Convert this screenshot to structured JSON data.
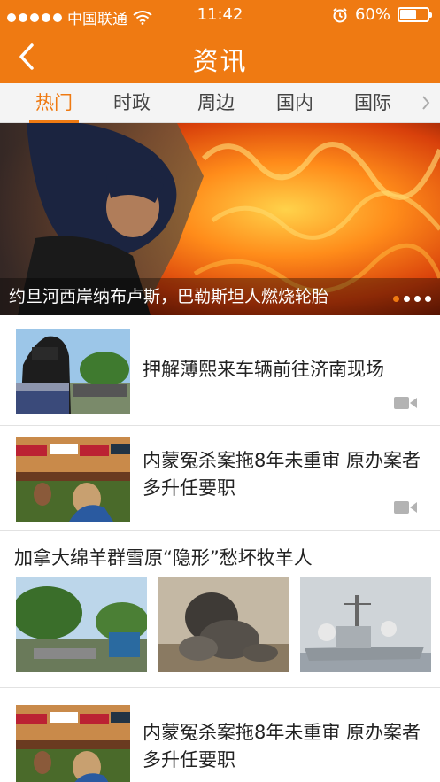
{
  "status": {
    "carrier": "中国联通",
    "time": "11:42",
    "battery_text": "60%",
    "battery_level": 0.6
  },
  "nav": {
    "title": "资讯",
    "back_icon": "chevron-left-icon"
  },
  "tabs": [
    {
      "label": "热门",
      "active": true
    },
    {
      "label": "时政",
      "active": false
    },
    {
      "label": "周边",
      "active": false
    },
    {
      "label": "国内",
      "active": false
    },
    {
      "label": "国际",
      "active": false
    }
  ],
  "banner": {
    "caption": "约旦河西岸纳布卢斯，巴勒斯坦人燃烧轮胎",
    "page_count": 4,
    "current_page": 1
  },
  "news": [
    {
      "title": "押解薄熙来车辆前往济南现场",
      "has_video": true
    },
    {
      "title": "内蒙冤杀案拖8年未重审 原办案者多升任要职",
      "has_video": true
    },
    {
      "title": "加拿大绵羊群雪原“隐形”愁坏牧羊人",
      "image_count": 3
    },
    {
      "title": "内蒙冤杀案拖8年未重审 原办案者多升任要职",
      "has_video": false
    }
  ],
  "colors": {
    "accent": "#ef7a12",
    "text": "#222222",
    "divider": "#e2e2e2"
  }
}
